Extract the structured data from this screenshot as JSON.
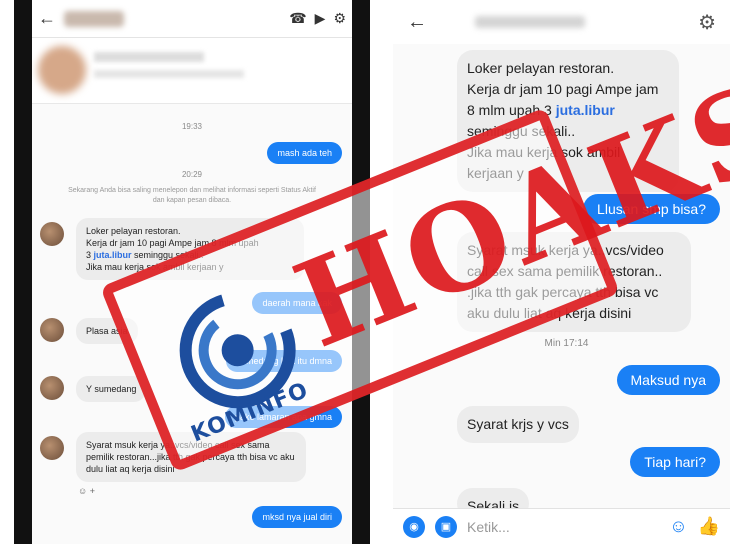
{
  "left": {
    "time_1": "19:33",
    "msg_out_1": "mash ada teh",
    "time_2": "20:29",
    "info": "Sekarang Anda bisa saling menelepon dan melihat informasi seperti Status Aktif dan kapan pesan dibaca.",
    "msg_in_1": {
      "line1": "Loker pelayan restoran.",
      "line2": "Kerja dr jam 10 pagi Ampe jam 8 mlm upah",
      "line3_pre": "3 ",
      "line3_link": "juta.libur",
      "line3_post": " seminggu sekali..",
      "line4": "Jika mau kerja sok ambil kerjaan y"
    },
    "msg_out_2": "daerah mana kak",
    "msg_in_2": "Plasa asia",
    "msg_out_3": "sumedang kak itu dmna",
    "msg_in_3": "Y sumedang",
    "msg_out_4": "pake lamaran apa gmna",
    "msg_in_4": "Syarat msuk kerja ya..vcs/video call sex sama pemilik restoran...jika tth gak percaya tth bisa vc aku dulu liat aq kerja disini",
    "msg_out_5": "mksd nya jual diri",
    "reaction": "☺ +"
  },
  "right": {
    "msg_in_1": {
      "line1": "Loker pelayan restoran.",
      "line2": "Kerja dr jam 10 pagi Ampe jam",
      "line3_pre": "8 mlm upah 3 ",
      "line3_link": "juta.libur",
      "line4": "seminggu sekali..",
      "line5": "Jika mau kerja sok ambil",
      "line6": "kerjaan y"
    },
    "msg_out_1": "Llusan smp bisa?",
    "msg_in_2": {
      "line1": "Syarat msuk kerja ya..vcs/video",
      "line2": "call sex sama pemilik restoran..",
      "line3": ".jika tth gak percaya tth bisa vc",
      "line4": "aku dulu liat aq kerja disini"
    },
    "time": "Min 17:14",
    "msg_out_2": "Maksud nya",
    "msg_in_3": "Syarat krjs y vcs",
    "msg_out_3": "Tiap hari?",
    "msg_in_4": "Sekali is",
    "input_placeholder": "Ketik..."
  },
  "stamp": {
    "text": "HOAKS",
    "logo_text": "KOMINFO"
  },
  "colors": {
    "bubble_out": "#1a80f5",
    "bubble_in": "#ececec",
    "stamp": "#dc181c",
    "logo": "#1d4e9e"
  }
}
